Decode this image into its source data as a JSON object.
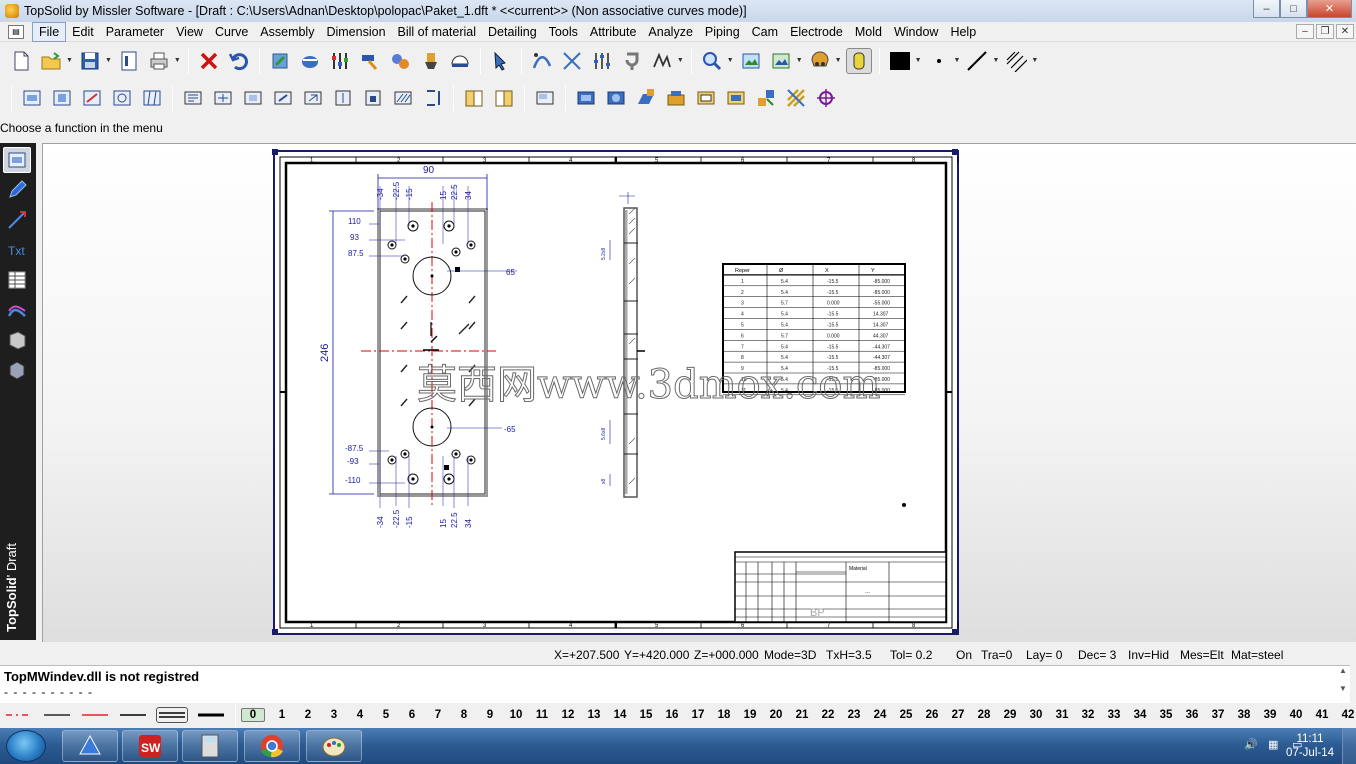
{
  "window": {
    "title": "TopSolid by Missler Software - [Draft : C:\\Users\\Adnan\\Desktop\\polopac\\Paket_1.dft *  <<current>> (Non associative curves mode)]",
    "min_glyph": "–",
    "max_glyph": "□",
    "close_glyph": "✕"
  },
  "menu": {
    "items": [
      "File",
      "Edit",
      "Parameter",
      "View",
      "Curve",
      "Assembly",
      "Dimension",
      "Bill of material",
      "Detailing",
      "Tools",
      "Attribute",
      "Analyze",
      "Piping",
      "Cam",
      "Electrode",
      "Mold",
      "Window",
      "Help"
    ],
    "mdi_min": "–",
    "mdi_restore": "❐",
    "mdi_close": "✕"
  },
  "prompt": "Choose a function in the menu",
  "brand": {
    "bold": "TopSolid",
    "rest": "' Draft"
  },
  "drawing": {
    "dims": {
      "top_width": "90",
      "top_row": [
        "-34",
        "-22.5",
        "-15",
        "15",
        "22.5",
        "34"
      ],
      "bottom_row": [
        "-34",
        "-22.5",
        "-15",
        "15",
        "22.5",
        "34"
      ],
      "left_top": [
        "110",
        "93",
        "87.5"
      ],
      "left_bottom": [
        "-87.5",
        "-93",
        "-110"
      ],
      "height": "246",
      "circle_top": "65",
      "circle_bottom": "-65"
    },
    "border_ticks": [
      "1",
      "2",
      "3",
      "4",
      "5",
      "6",
      "7",
      "8"
    ],
    "table": {
      "headers": [
        "Reper",
        "Ø",
        "X",
        "Y"
      ],
      "rows": [
        [
          "1",
          "5.4",
          "-15.5",
          "-85.000"
        ],
        [
          "2",
          "5.4",
          "-15.5",
          "-85.000"
        ],
        [
          "3",
          "5.7",
          "0.000",
          "-55.000"
        ],
        [
          "4",
          "5.4",
          "-15.5",
          "14.307"
        ],
        [
          "5",
          "5.4",
          "-15.5",
          "14.307"
        ],
        [
          "6",
          "5.7",
          "0.000",
          "44.307"
        ],
        [
          "7",
          "5.4",
          "-15.5",
          "-44.307"
        ],
        [
          "8",
          "5.4",
          "-15.5",
          "-44.307"
        ],
        [
          "9",
          "5.4",
          "-15.5",
          "-85.000"
        ],
        [
          "10",
          "5.4",
          "-15.5",
          "-85.000"
        ],
        [
          "11",
          "5.4",
          "-15.5",
          "-85.000"
        ]
      ]
    },
    "title_block": {
      "material": "Material",
      "initials": "BP"
    },
    "watermark": "莫西网www.3dmox.com"
  },
  "status": {
    "x": "X=+207.500",
    "y": "Y=+420.000",
    "z": "Z=+000.000",
    "mode": "Mode=3D",
    "txh": "TxH=3.5",
    "tol": "Tol=  0.2",
    "on": "On",
    "tra": "Tra=0",
    "lay": "Lay=  0",
    "dec": "Dec= 3",
    "inv": "Inv=Hid",
    "mes": "Mes=Elt",
    "mat": "Mat=steel"
  },
  "messages": {
    "line1": "TopMWindev.dll is not registred",
    "line2": "- - - - - - - - - -"
  },
  "layers": [
    "0",
    "1",
    "2",
    "3",
    "4",
    "5",
    "6",
    "7",
    "8",
    "9",
    "10",
    "11",
    "12",
    "13",
    "14",
    "15",
    "16",
    "17",
    "18",
    "19",
    "20",
    "21",
    "22",
    "23",
    "24",
    "25",
    "26",
    "27",
    "28",
    "29",
    "30",
    "31",
    "32",
    "33",
    "34",
    "35",
    "36",
    "37",
    "38",
    "39",
    "40",
    "41",
    "42"
  ],
  "taskbar": {
    "time": "11:11",
    "date": "07-Jul-14"
  },
  "colors": {
    "dimension": "#1a1aa8",
    "axis": "#d00000",
    "frame": "#000000",
    "paper_edge": "#1a1a70"
  }
}
